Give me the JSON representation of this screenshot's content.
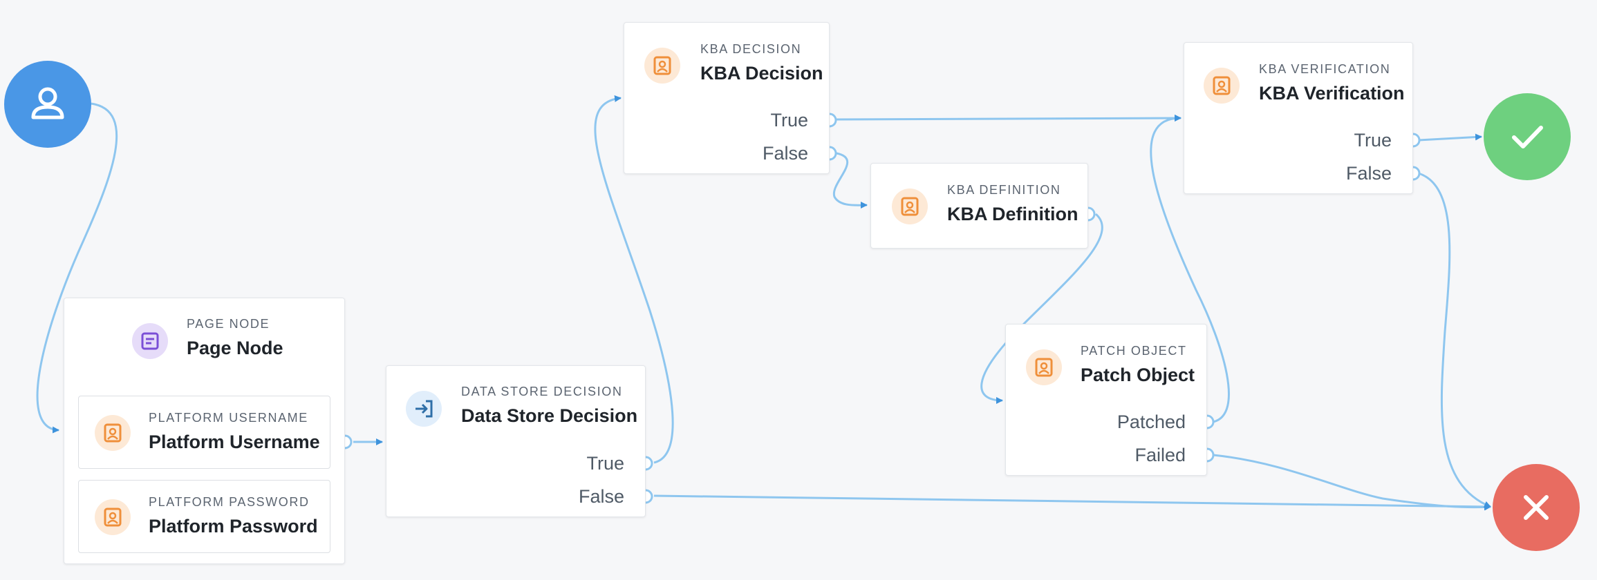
{
  "start": {
    "icon": "user-icon",
    "color": "#4a97e6"
  },
  "success": {
    "icon": "check-icon",
    "color": "#6ed07f"
  },
  "failure": {
    "icon": "close-icon",
    "color": "#e86c61"
  },
  "page_node": {
    "subtitle": "PAGE NODE",
    "title": "Page Node",
    "icon": "page-icon",
    "children": [
      {
        "subtitle": "PLATFORM USERNAME",
        "title": "Platform Username",
        "icon": "person-card-icon"
      },
      {
        "subtitle": "PLATFORM PASSWORD",
        "title": "Platform Password",
        "icon": "person-card-icon"
      }
    ]
  },
  "data_store_decision": {
    "subtitle": "DATA STORE DECISION",
    "title": "Data Store Decision",
    "icon": "login-arrow-icon",
    "outcomes": [
      "True",
      "False"
    ]
  },
  "kba_decision": {
    "subtitle": "KBA DECISION",
    "title": "KBA Decision",
    "icon": "person-card-icon",
    "outcomes": [
      "True",
      "False"
    ]
  },
  "kba_definition": {
    "subtitle": "KBA DEFINITION",
    "title": "KBA Definition",
    "icon": "person-card-icon"
  },
  "patch_object": {
    "subtitle": "PATCH OBJECT",
    "title": "Patch Object",
    "icon": "person-card-icon",
    "outcomes": [
      "Patched",
      "Failed"
    ]
  },
  "kba_verification": {
    "subtitle": "KBA VERIFICATION",
    "title": "KBA Verification",
    "icon": "person-card-icon",
    "outcomes": [
      "True",
      "False"
    ]
  },
  "colors": {
    "wire": "#8ec6ef",
    "arrow": "#3e93dc",
    "orange_icon": "#ef8f3a",
    "purple_icon": "#7b4fd6",
    "blue_icon": "#2f6fa8"
  }
}
